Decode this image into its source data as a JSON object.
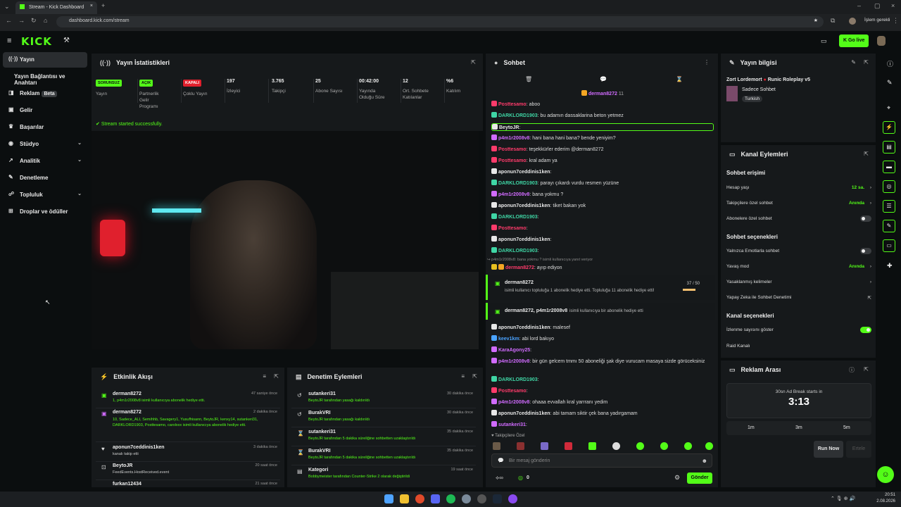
{
  "browser": {
    "tab_title": "Stream - Kick Dashboard",
    "url": "dashboard.kick.com/stream",
    "profile_label": "İşlem gerekli"
  },
  "header": {
    "logo": "KICK",
    "golive_label": "Go live"
  },
  "sidebar": {
    "items": [
      {
        "label": "Yayın",
        "active": true
      },
      {
        "label": "Yayın Bağlantısı ve Anahtarı"
      },
      {
        "label": "Reklam",
        "badge": "Beta"
      },
      {
        "label": "Gelir"
      },
      {
        "label": "Başarılar"
      },
      {
        "label": "Stüdyo"
      },
      {
        "label": "Analitik"
      },
      {
        "label": "Denetleme"
      },
      {
        "label": "Topluluk"
      },
      {
        "label": "Droplar ve ödüller"
      }
    ]
  },
  "stats_panel": {
    "title": "Yayın İstatistikleri",
    "items": [
      {
        "pill": "SORUNSUZ",
        "label": "Yayın"
      },
      {
        "pill": "AÇIK",
        "label": "Partnerlik Gelir Programı"
      },
      {
        "pill": "KAPALI",
        "label": "Çoklu Yayın"
      },
      {
        "value": "197",
        "label": "İzleyici"
      },
      {
        "value": "3.765",
        "label": "Takipçi"
      },
      {
        "value": "25",
        "label": "Abone Sayısı"
      },
      {
        "value": "00:42:00",
        "label": "Yayında Olduğu Süre"
      },
      {
        "value": "12",
        "label": "Ort. Sohbete Katılanlar"
      },
      {
        "value": "%6",
        "label": "Katılım"
      }
    ],
    "notice": "Stream started successfully."
  },
  "activity_feed": {
    "title": "Etkinlik Akışı",
    "rows": [
      {
        "name": "derman8272",
        "desc": "1, p4m1r2008v8 isimli kullanıcıya abonelik hediye etti.",
        "time": "47 saniye önce"
      },
      {
        "name": "derman8272",
        "desc": "10, Sadece_ALI, Semihhb, Savagery1, Yusufhisann, BeytoJR, kenxy14, sutankeri31, DARKLORD1903, Posttesamo, carolxxx isimli kullanıcıya abonelik hediye etti.",
        "time": "2 dakika önce"
      },
      {
        "name": "aponun7ceddinis1ken",
        "desc": "kanalı takip etti",
        "time": "3 dakika önce"
      },
      {
        "name": "BeytoJR",
        "desc": "FeedEvents.HostReceived.event",
        "time": "20 saat önce"
      },
      {
        "name": "furkan12434",
        "desc": "",
        "time": "21 saat önce"
      }
    ]
  },
  "mod_actions": {
    "title": "Denetim Eylemleri",
    "rows": [
      {
        "name": "sutankeri31",
        "desc": "BeytoJR tarafından yasağı kaldırıldı",
        "time": "30 dakika önce"
      },
      {
        "name": "BurakVRI",
        "desc": "BeytoJR tarafından yasağı kaldırıldı",
        "time": "30 dakika önce"
      },
      {
        "name": "sutankeri31",
        "desc": "BeytoJR tarafından 5 dakika süreliğine sohbetten uzaklaştırıldı",
        "time": "35 dakika önce"
      },
      {
        "name": "BurakVRI",
        "desc": "BeytoJR tarafından 5 dakika süreliğine sohbetten uzaklaştırıldı",
        "time": "35 dakika önce"
      },
      {
        "name": "Kategori",
        "desc": "Bobbymeister tarafından Counter-Strike 2 olarak değiştirildi",
        "time": "19 saat önce"
      }
    ]
  },
  "chat": {
    "title": "Sohbet",
    "pinned_user": "derman8272",
    "pinned_count": "11",
    "messages": [
      {
        "user": "Posttesamo",
        "text": ": aboo",
        "color": "#ff3b6b"
      },
      {
        "user": "DARKLORD1903",
        "text": ": bu adamın dassaklarina beton yetmez",
        "color": "#3fd6a5"
      },
      {
        "user": "BeytoJR",
        "text": ":",
        "color": "#e8e8e8"
      },
      {
        "user": "p4m1r2008v8",
        "text": ": hani bana hani bana? bende yeniyim?",
        "color": "#d16bff"
      },
      {
        "user": "Posttesamo",
        "text": ": teşekkürler ederim @derman8272",
        "color": "#ff3b6b"
      },
      {
        "user": "Posttesamo",
        "text": ": kral adam ya",
        "color": "#ff3b6b"
      },
      {
        "user": "aponun7ceddinis1ken",
        "text": ":",
        "color": "#e8e8e8"
      },
      {
        "user": "DARKLORD1903",
        "text": ": parayı çıkardı vurdu resmen yüzüne",
        "color": "#3fd6a5"
      },
      {
        "user": "p4m1r2008v8",
        "text": ": bana yokmu ?",
        "color": "#d16bff"
      },
      {
        "user": "aponun7ceddinis1ken",
        "text": ": tiket bakan yok",
        "color": "#e8e8e8"
      },
      {
        "user": "DARKLORD1903",
        "text": ":",
        "color": "#3fd6a5"
      },
      {
        "user": "Posttesamo",
        "text": ":",
        "color": "#ff3b6b"
      },
      {
        "user": "aponun7ceddinis1ken",
        "text": ":",
        "color": "#e8e8e8"
      },
      {
        "user": "DARKLORD1903",
        "text": ":",
        "color": "#3fd6a5"
      }
    ],
    "reply_note": "p4m1r2008v8: bana yokmu ? isimli kullanıcıya yanıt veriyor",
    "reply_msg": {
      "user": "derman8272",
      "text": ": ayıp ediyon"
    },
    "gift1": {
      "user": "derman8272",
      "text": "isimli kullanıcı topluluğa 1 abonelik hediye etti. Topluluğa 11 abonelik hediye etti!",
      "progress": "37 / 50"
    },
    "gift2": {
      "users": "derman8272, p4m1r2008v8",
      "text": "isimli kullanıcıya bir abonelik hediye etti"
    },
    "messages2": [
      {
        "user": "aponun7ceddinis1ken",
        "text": ": malesef",
        "color": "#e8e8e8"
      },
      {
        "user": "keev1km",
        "text": ": abi lord bakıyo",
        "color": "#4aa3ff"
      },
      {
        "user": "KaraAgony25",
        "text": ":",
        "color": "#d16bff"
      },
      {
        "user": "p4m1r2008v8",
        "text": ": bir gün gelcem tmmı 50 aboneliği şak diye vurucam masaya sizde görüceksiniz",
        "color": "#d16bff"
      },
      {
        "user": "DARKLORD1903",
        "text": ":",
        "color": "#3fd6a5"
      },
      {
        "user": "Posttesamo",
        "text": ":",
        "color": "#ff3b6b"
      },
      {
        "user": "p4m1r2008v8",
        "text": ": ohaaa evvallah kral yarrranı yedim",
        "color": "#d16bff"
      },
      {
        "user": "aponun7ceddinis1ken",
        "text": ": abi tamam siktir çek bana yadırgamam",
        "color": "#e8e8e8"
      },
      {
        "user": "sutankeri31",
        "text": ":",
        "color": "#d16bff"
      }
    ],
    "emote_label": "Takipçilere Özel",
    "input_placeholder": "Bir mesaj gönderin",
    "points": "0",
    "send_label": "Gönder"
  },
  "stream_info": {
    "title": "Yayın bilgisi",
    "streamer": "Zort Lordemort",
    "category": "Runic Roleplay v5",
    "chat_mode": "Sadece Sohbet",
    "tag": "Turkish"
  },
  "channel_actions": {
    "title": "Kanal Eylemleri",
    "section_chat_access": "Sohbet erişimi",
    "account_age": {
      "label": "Hesap yaşı",
      "value": "12 sa."
    },
    "followers_only": {
      "label": "Takipçilere özel sohbet",
      "value": "Anında"
    },
    "subs_only": {
      "label": "Abonelere özel sohbet",
      "on": false
    },
    "section_chat_options": "Sohbet seçenekleri",
    "emotes_only": {
      "label": "Yalnızca Emotlarla sohbet",
      "on": false
    },
    "slow_mode": {
      "label": "Yavaş mod",
      "value": "Anında"
    },
    "banned_words": {
      "label": "Yasaklanmış kelimeler"
    },
    "ai_mod": {
      "label": "Yapay Zeka ile Sohbet Denetimi"
    },
    "section_channel": "Kanal seçenekleri",
    "show_viewers": {
      "label": "İzlenme sayısını göster",
      "on": true
    },
    "raid": {
      "label": "Raid Kanalı"
    }
  },
  "ad_break": {
    "title": "Reklam Arası",
    "starts_in_label": "30sn Ad Break starts in",
    "countdown": "3:13",
    "options": [
      "1m",
      "3m",
      "5m"
    ],
    "run_now": "Run Now",
    "later": "Ertele"
  },
  "taskbar": {
    "time": "20:51",
    "date": "2.08.2026"
  },
  "colors": {
    "accent": "#53fc18",
    "bg": "#0b0e0f",
    "panel": "#16191b"
  }
}
